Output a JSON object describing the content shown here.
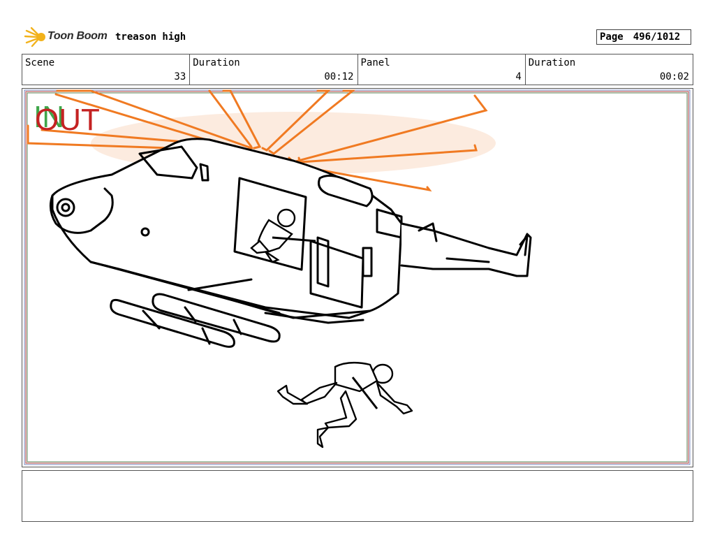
{
  "header": {
    "logo_text": "Toon Boom",
    "project_title": "treason high",
    "page_label": "Page",
    "page_number": "496/1012"
  },
  "info": {
    "scene_label": "Scene",
    "scene_value": "33",
    "scene_duration_label": "Duration",
    "scene_duration_value": "00:12",
    "panel_label": "Panel",
    "panel_value": "4",
    "panel_duration_label": "Duration",
    "panel_duration_value": "00:02"
  },
  "panel": {
    "in_marker": "IN",
    "out_marker": "OUT"
  },
  "colors": {
    "accent_orange": "#f07a22",
    "window_fill": "#f6b08a",
    "in_green": "#3fa64a",
    "out_red": "#c42222"
  },
  "notes": {
    "text": ""
  }
}
